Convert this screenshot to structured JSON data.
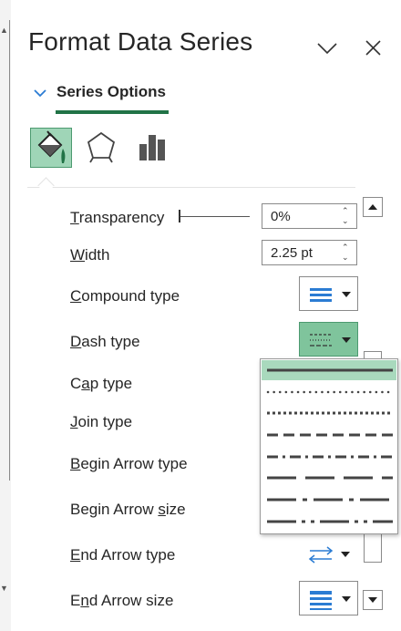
{
  "pane": {
    "title": "Format Data Series",
    "tab": "Series Options",
    "category_icons": [
      "fill-line-icon",
      "effects-pentagon-icon",
      "series-options-bars-icon"
    ]
  },
  "rows": {
    "transparency": {
      "pre": "",
      "key": "T",
      "post": "ransparency",
      "value": "0%",
      "level": 0
    },
    "width": {
      "pre": "",
      "key": "W",
      "post": "idth",
      "value": "2.25 pt"
    },
    "compound": {
      "pre": "",
      "key": "C",
      "post": "ompound type"
    },
    "dash": {
      "pre": "",
      "key": "D",
      "post": "ash type"
    },
    "cap": {
      "pre": "C",
      "key": "a",
      "post": "p type"
    },
    "join": {
      "pre": "",
      "key": "J",
      "post": "oin type"
    },
    "begin_arrow_type": {
      "pre": "",
      "key": "B",
      "post": "egin Arrow type"
    },
    "begin_arrow_size": {
      "pre": "Begin Arrow ",
      "key": "s",
      "post": "ize"
    },
    "end_arrow_type": {
      "pre": "",
      "key": "E",
      "post": "nd Arrow type"
    },
    "end_arrow_size": {
      "pre": "E",
      "key": "n",
      "post": "d Arrow size"
    }
  },
  "dash_options": [
    "solid",
    "round-dot",
    "square-dot",
    "dash",
    "dash-dot",
    "long-dash",
    "long-dash-dot",
    "long-dash-dot-dot"
  ],
  "selected_dash": "solid",
  "colors": {
    "accent": "#217346",
    "active_fill": "#9fd5b7",
    "icon_blue": "#2b7cd3"
  }
}
